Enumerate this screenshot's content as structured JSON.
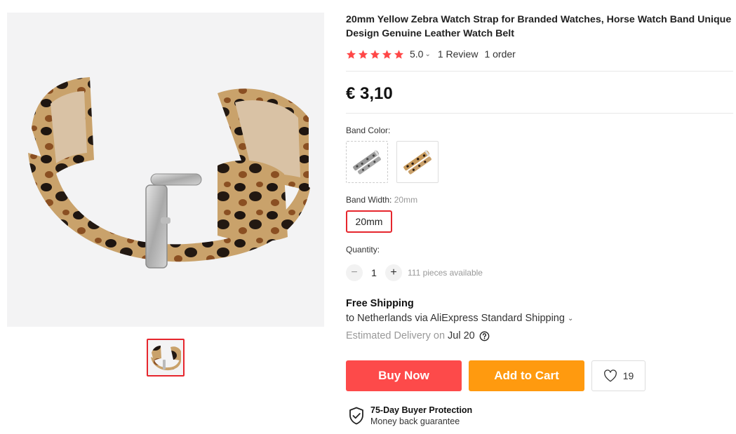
{
  "product": {
    "title": "20mm Yellow Zebra Watch Strap for Branded Watches, Horse Watch Band Unique Design Genuine Leather Watch Belt",
    "rating": "5.0",
    "reviews": "1 Review",
    "orders": "1 order",
    "price": "€ 3,10"
  },
  "gallery": {
    "main_image": "leopard-print-watch-strap-photo",
    "thumbnails": [
      "leopard-print-watch-strap-thumb"
    ]
  },
  "options": {
    "band_color_label": "Band Color:",
    "band_colors": [
      "grey-leopard-strap",
      "brown-leopard-strap"
    ],
    "band_width_label": "Band Width:",
    "band_width_selected": "20mm",
    "band_width_option": "20mm"
  },
  "quantity": {
    "label": "Quantity:",
    "minus": "−",
    "value": "1",
    "plus": "+",
    "available": "111 pieces available"
  },
  "shipping": {
    "title": "Free Shipping",
    "route": "to Netherlands via AliExpress Standard Shipping",
    "delivery_label": "Estimated Delivery on",
    "delivery_date": "Jul 20"
  },
  "actions": {
    "buy_now": "Buy Now",
    "add_to_cart": "Add to Cart",
    "wishlist_count": "19"
  },
  "protection": {
    "title": "75-Day Buyer Protection",
    "subtitle": "Money back guarantee"
  },
  "colors": {
    "accent_red": "#fd4a4a",
    "accent_orange": "#ff9a0f",
    "star": "#ff4747",
    "selected_border": "#e6262d"
  }
}
